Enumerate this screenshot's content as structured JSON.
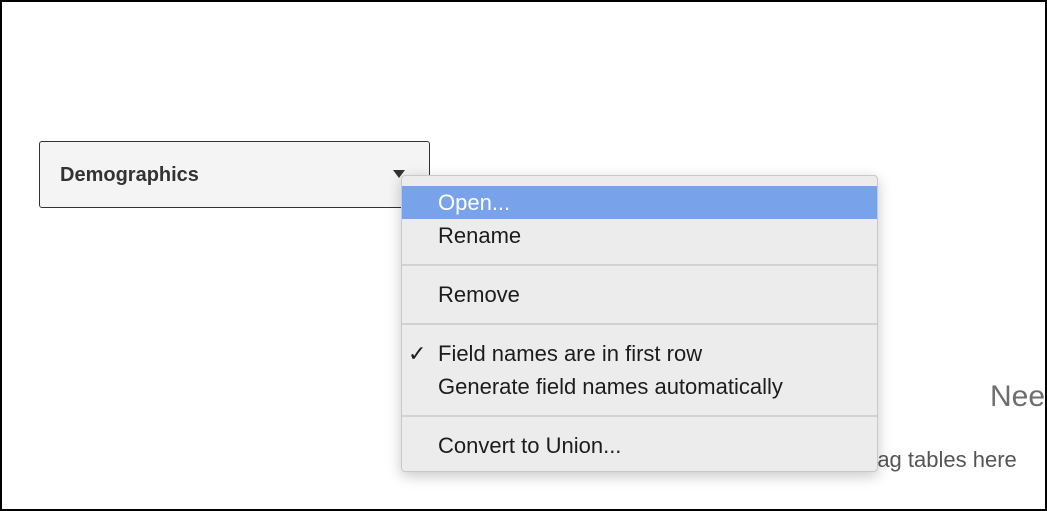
{
  "table": {
    "name": "Demographics",
    "icon": "caret-down-icon"
  },
  "background": {
    "title_partial": "Nee",
    "subtitle_partial": "rag tables here"
  },
  "menu": {
    "items": [
      {
        "label": "Open...",
        "highlighted": true
      },
      {
        "label": "Rename"
      },
      {
        "label": "Remove"
      },
      {
        "label": "Field names are in first row",
        "checked": true,
        "check_glyph": "✓"
      },
      {
        "label": "Generate field names automatically"
      },
      {
        "label": "Convert to Union..."
      }
    ],
    "highlight_color": "#78a3ea"
  }
}
